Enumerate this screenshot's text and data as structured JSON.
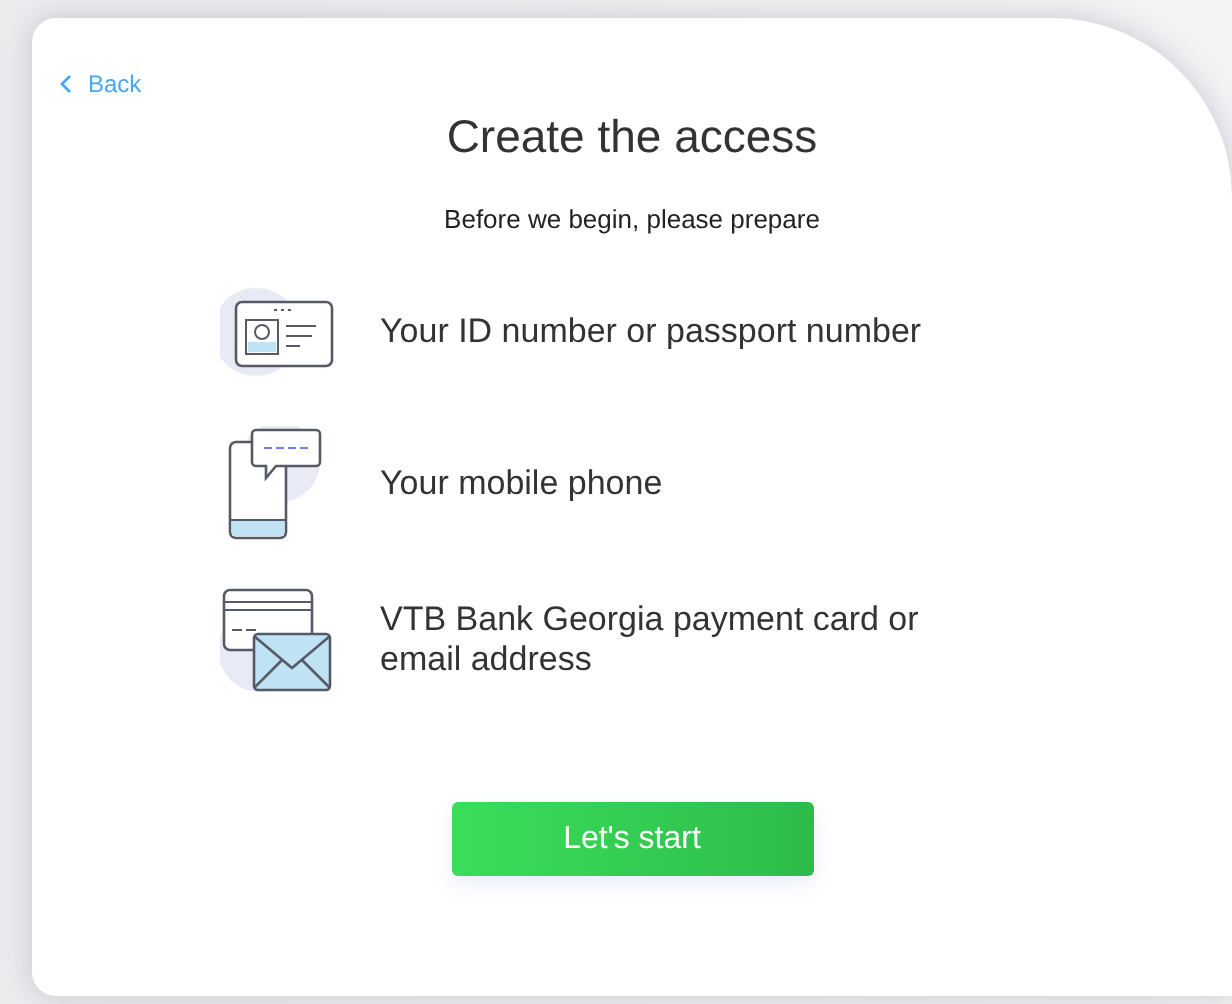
{
  "back_link": "Back",
  "title": "Create the access",
  "subtitle": "Before we begin, please prepare",
  "items": [
    {
      "kind": "id",
      "label": "Your ID number or passport number"
    },
    {
      "kind": "phone",
      "label": "Your mobile phone"
    },
    {
      "kind": "card",
      "label": "VTB Bank Georgia payment card or email address"
    }
  ],
  "start_button": "Let's start"
}
